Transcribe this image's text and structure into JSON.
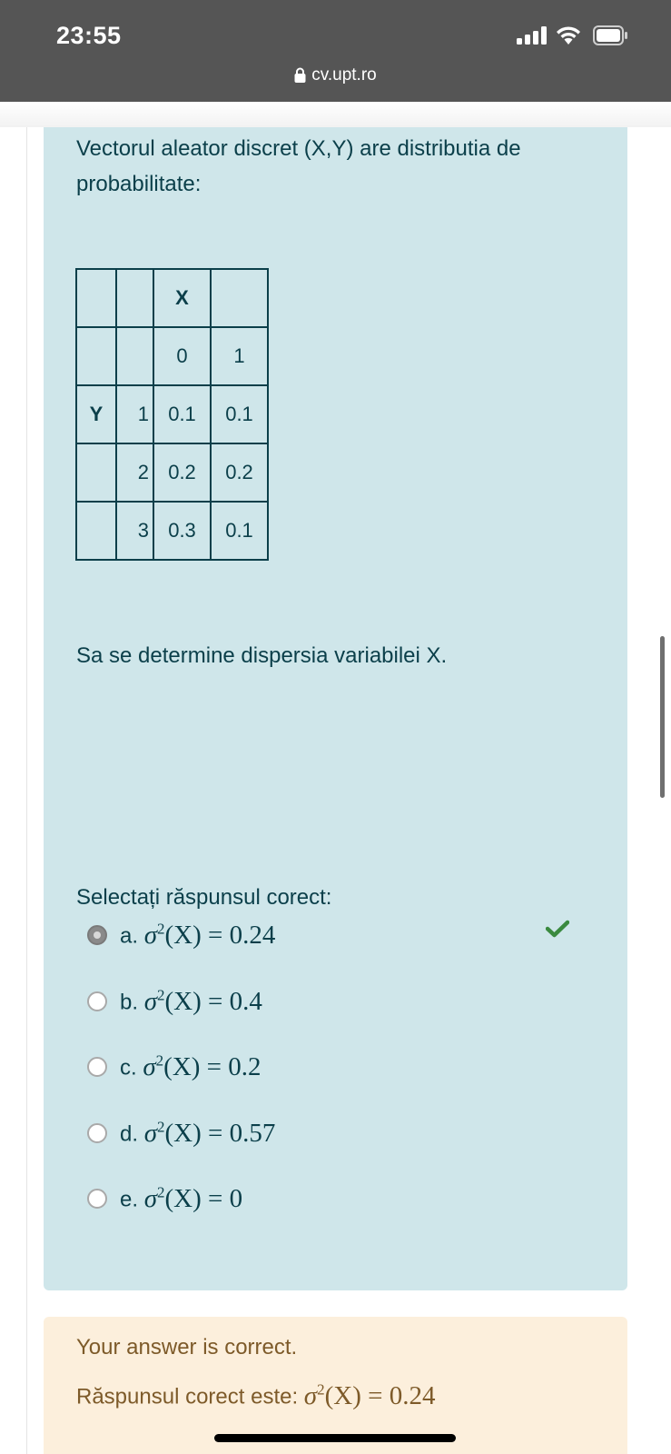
{
  "status_bar": {
    "time": "23:55",
    "url": "cv.upt.ro"
  },
  "question": {
    "text": "Vectorul aleator discret (X,Y) are distributia de probabilitate:",
    "table": [
      [
        "",
        "",
        "X",
        ""
      ],
      [
        "",
        "",
        "0",
        "1"
      ],
      [
        "Y",
        "1",
        "0.1",
        "0.1"
      ],
      [
        "",
        "2",
        "0.2",
        "0.2"
      ],
      [
        "",
        "3",
        "0.3",
        "0.1"
      ]
    ],
    "ask": "Sa se determine dispersia variabilei X.",
    "select_heading": "Selectați răspunsul corect:",
    "options": [
      {
        "letter": "a.",
        "value": "0.24",
        "selected": true
      },
      {
        "letter": "b.",
        "value": "0.4",
        "selected": false
      },
      {
        "letter": "c.",
        "value": "0.2",
        "selected": false
      },
      {
        "letter": "d.",
        "value": "0.57",
        "selected": false
      },
      {
        "letter": "e.",
        "value": "0",
        "selected": false
      }
    ],
    "formula_prefix": "σ",
    "formula_sup": "2",
    "formula_var": "(X)",
    "formula_eq": " = ",
    "correct_icon": "check-icon",
    "correct_color": "#3a8a3f"
  },
  "feedback": {
    "result": "Your answer is correct.",
    "correct_label": "Răspunsul corect este: ",
    "correct_value": "0.24"
  }
}
